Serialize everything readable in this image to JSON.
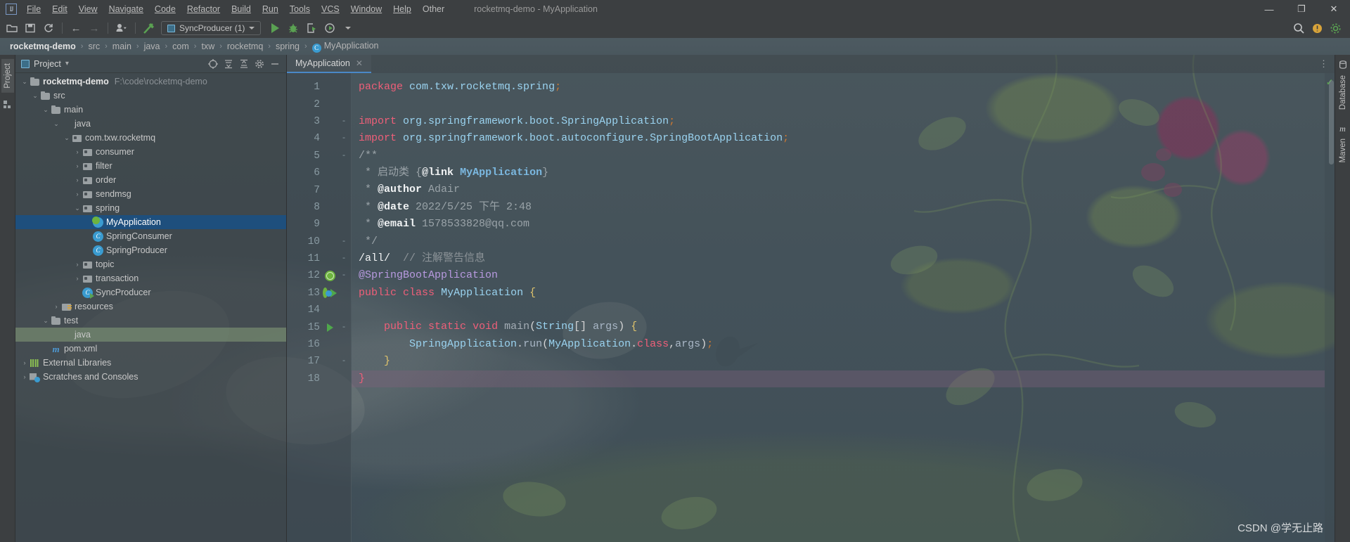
{
  "window": {
    "title": "rocketmq-demo - MyApplication",
    "logo": "IJ",
    "controls": {
      "minimize": "—",
      "maximize": "❐",
      "close": "✕"
    }
  },
  "menubar": {
    "items": [
      {
        "label": "File"
      },
      {
        "label": "Edit"
      },
      {
        "label": "View"
      },
      {
        "label": "Navigate"
      },
      {
        "label": "Code"
      },
      {
        "label": "Refactor"
      },
      {
        "label": "Build"
      },
      {
        "label": "Run"
      },
      {
        "label": "Tools"
      },
      {
        "label": "VCS"
      },
      {
        "label": "Window"
      },
      {
        "label": "Help"
      },
      {
        "label": "Other"
      }
    ]
  },
  "toolbar": {
    "open_icon": "open-folder-icon",
    "save_icon": "save-all-icon",
    "sync_icon": "refresh-icon",
    "back_icon": "←",
    "forward_icon": "→",
    "profile_icon": "user-profile-icon",
    "build_icon": "build-hammer-icon",
    "run_config_label": "SyncProducer (1)",
    "run_label": "run-button",
    "debug_label": "debug-button",
    "coverage_label": "run-with-coverage-button",
    "profile_label": "profiler-button",
    "search_icon": "search-everywhere-icon",
    "settings_icon": "settings-gear-icon",
    "updates_icon": "ide-updates-icon"
  },
  "breadcrumb": {
    "items": [
      {
        "label": "rocketmq-demo",
        "type": "project"
      },
      {
        "label": "src",
        "type": "dir"
      },
      {
        "label": "main",
        "type": "dir"
      },
      {
        "label": "java",
        "type": "dir"
      },
      {
        "label": "com",
        "type": "dir"
      },
      {
        "label": "txw",
        "type": "dir"
      },
      {
        "label": "rocketmq",
        "type": "dir"
      },
      {
        "label": "spring",
        "type": "dir"
      },
      {
        "label": "MyApplication",
        "type": "class"
      }
    ],
    "separator": "›"
  },
  "left_strip": {
    "tabs": [
      {
        "label": "Project",
        "active": true
      }
    ],
    "structure_icon": "structure-icon"
  },
  "right_strip": {
    "tabs": [
      {
        "label": "Database"
      },
      {
        "label": "Maven"
      }
    ]
  },
  "project_panel": {
    "title": "Project",
    "dropdown": "▾",
    "tools": [
      "locate-icon",
      "expand-all-icon",
      "collapse-all-icon",
      "settings-gear-icon",
      "hide-icon"
    ],
    "tree": [
      {
        "indent": 0,
        "arrow": "v",
        "icon": "project",
        "label": "rocketmq-demo",
        "bold": true,
        "path": "F:\\code\\rocketmq-demo"
      },
      {
        "indent": 1,
        "arrow": "v",
        "icon": "folder",
        "label": "src"
      },
      {
        "indent": 2,
        "arrow": "v",
        "icon": "folder",
        "label": "main"
      },
      {
        "indent": 3,
        "arrow": "v",
        "icon": "srcjava",
        "label": "java"
      },
      {
        "indent": 4,
        "arrow": "v",
        "icon": "package",
        "label": "com.txw.rocketmq"
      },
      {
        "indent": 5,
        "arrow": ">",
        "icon": "package",
        "label": "consumer"
      },
      {
        "indent": 5,
        "arrow": ">",
        "icon": "package",
        "label": "filter"
      },
      {
        "indent": 5,
        "arrow": ">",
        "icon": "package",
        "label": "order"
      },
      {
        "indent": 5,
        "arrow": ">",
        "icon": "package",
        "label": "sendmsg"
      },
      {
        "indent": 5,
        "arrow": "v",
        "icon": "package",
        "label": "spring"
      },
      {
        "indent": 6,
        "arrow": "",
        "icon": "springcls",
        "label": "MyApplication",
        "selected": true
      },
      {
        "indent": 6,
        "arrow": "",
        "icon": "class",
        "label": "SpringConsumer"
      },
      {
        "indent": 6,
        "arrow": "",
        "icon": "class",
        "label": "SpringProducer"
      },
      {
        "indent": 5,
        "arrow": ">",
        "icon": "package",
        "label": "topic"
      },
      {
        "indent": 5,
        "arrow": ">",
        "icon": "package",
        "label": "transaction"
      },
      {
        "indent": 5,
        "arrow": "",
        "icon": "classrun",
        "label": "SyncProducer"
      },
      {
        "indent": 3,
        "arrow": ">",
        "icon": "resources",
        "label": "resources"
      },
      {
        "indent": 2,
        "arrow": "v",
        "icon": "folder",
        "label": "test"
      },
      {
        "indent": 3,
        "arrow": "",
        "icon": "testjava",
        "label": "java",
        "selectedGreen": true
      },
      {
        "indent": 2,
        "arrow": "",
        "icon": "maven",
        "label": "pom.xml"
      },
      {
        "indent": 0,
        "arrow": ">",
        "icon": "libs",
        "label": "External Libraries"
      },
      {
        "indent": 0,
        "arrow": ">",
        "icon": "scratch",
        "label": "Scratches and Consoles"
      }
    ]
  },
  "editor": {
    "tabs": [
      {
        "label": "MyApplication",
        "close": "✕",
        "active": true
      }
    ],
    "kebab": "⋮",
    "inspection_status": "✓",
    "lines": [
      {
        "n": 1,
        "gutter": "",
        "fold": "",
        "tokens": [
          {
            "t": "package",
            "c": "kw"
          },
          {
            "t": " ",
            "c": "pun"
          },
          {
            "t": "com.txw.rocketmq.spring",
            "c": "id"
          },
          {
            "t": ";",
            "c": "semi"
          }
        ]
      },
      {
        "n": 2,
        "gutter": "",
        "fold": "",
        "tokens": []
      },
      {
        "n": 3,
        "gutter": "",
        "fold": "-",
        "tokens": [
          {
            "t": "import",
            "c": "kw"
          },
          {
            "t": " ",
            "c": "pun"
          },
          {
            "t": "org.springframework.boot.SpringApplication",
            "c": "id"
          },
          {
            "t": ";",
            "c": "semi"
          }
        ]
      },
      {
        "n": 4,
        "gutter": "",
        "fold": "-",
        "tokens": [
          {
            "t": "import",
            "c": "kw"
          },
          {
            "t": " ",
            "c": "pun"
          },
          {
            "t": "org.springframework.boot.autoconfigure.SpringBootApplication",
            "c": "id"
          },
          {
            "t": ";",
            "c": "semi"
          }
        ]
      },
      {
        "n": 5,
        "gutter": "",
        "fold": "-",
        "tokens": [
          {
            "t": "/**",
            "c": "doc"
          }
        ]
      },
      {
        "n": 6,
        "gutter": "",
        "fold": "",
        "tokens": [
          {
            "t": " * ",
            "c": "doc"
          },
          {
            "t": "启动类 ",
            "c": "doc"
          },
          {
            "t": "{",
            "c": "doc"
          },
          {
            "t": "@link",
            "c": "doctag"
          },
          {
            "t": " ",
            "c": "doc"
          },
          {
            "t": "MyApplication",
            "c": "doclink"
          },
          {
            "t": "}",
            "c": "doc"
          }
        ]
      },
      {
        "n": 7,
        "gutter": "",
        "fold": "",
        "tokens": [
          {
            "t": " * ",
            "c": "doc"
          },
          {
            "t": "@author",
            "c": "doctag"
          },
          {
            "t": " Adair",
            "c": "doc"
          }
        ]
      },
      {
        "n": 8,
        "gutter": "",
        "fold": "",
        "tokens": [
          {
            "t": " * ",
            "c": "doc"
          },
          {
            "t": "@date",
            "c": "doctag"
          },
          {
            "t": " 2022/5/25 下午 2:48",
            "c": "doc"
          }
        ]
      },
      {
        "n": 9,
        "gutter": "",
        "fold": "",
        "tokens": [
          {
            "t": " * ",
            "c": "doc"
          },
          {
            "t": "@email",
            "c": "doctag"
          },
          {
            "t": " 1578533828@qq.com",
            "c": "doc"
          }
        ]
      },
      {
        "n": 10,
        "gutter": "",
        "fold": "-",
        "tokens": [
          {
            "t": " */",
            "c": "doc"
          }
        ]
      },
      {
        "n": 11,
        "gutter": "",
        "fold": "-",
        "tokens": [
          {
            "t": "/all/",
            "c": "white"
          },
          {
            "t": "  ",
            "c": "pun"
          },
          {
            "t": "// 注解警告信息",
            "c": "cmt"
          }
        ]
      },
      {
        "n": 12,
        "gutter": "spring-bean",
        "fold": "-",
        "tokens": [
          {
            "t": "@SpringBootApplication",
            "c": "anno"
          }
        ]
      },
      {
        "n": 13,
        "gutter": "spring-nav-run",
        "fold": "",
        "tokens": [
          {
            "t": "public",
            "c": "kw"
          },
          {
            "t": " ",
            "c": "pun"
          },
          {
            "t": "class",
            "c": "kw"
          },
          {
            "t": " ",
            "c": "pun"
          },
          {
            "t": "MyApplication",
            "c": "id"
          },
          {
            "t": " ",
            "c": "pun"
          },
          {
            "t": "{",
            "c": "brace"
          }
        ]
      },
      {
        "n": 14,
        "gutter": "",
        "fold": "",
        "tokens": []
      },
      {
        "n": 15,
        "gutter": "run",
        "fold": "-",
        "tokens": [
          {
            "t": "    ",
            "c": "pun"
          },
          {
            "t": "public",
            "c": "kw"
          },
          {
            "t": " ",
            "c": "pun"
          },
          {
            "t": "static",
            "c": "kw"
          },
          {
            "t": " ",
            "c": "pun"
          },
          {
            "t": "void",
            "c": "kw"
          },
          {
            "t": " ",
            "c": "pun"
          },
          {
            "t": "main",
            "c": "mth"
          },
          {
            "t": "(",
            "c": "pun"
          },
          {
            "t": "String",
            "c": "id"
          },
          {
            "t": "[] ",
            "c": "pun"
          },
          {
            "t": "args",
            "c": "ident"
          },
          {
            "t": ") ",
            "c": "pun"
          },
          {
            "t": "{",
            "c": "brace"
          }
        ]
      },
      {
        "n": 16,
        "gutter": "",
        "fold": "",
        "tokens": [
          {
            "t": "        ",
            "c": "pun"
          },
          {
            "t": "SpringApplication",
            "c": "id"
          },
          {
            "t": ".",
            "c": "pun"
          },
          {
            "t": "run",
            "c": "ident"
          },
          {
            "t": "(",
            "c": "pun"
          },
          {
            "t": "MyApplication",
            "c": "id"
          },
          {
            "t": ".",
            "c": "pun"
          },
          {
            "t": "class",
            "c": "kw"
          },
          {
            "t": ",",
            "c": "pun"
          },
          {
            "t": "args",
            "c": "ident"
          },
          {
            "t": ")",
            "c": "pun"
          },
          {
            "t": ";",
            "c": "semi"
          }
        ]
      },
      {
        "n": 17,
        "gutter": "",
        "fold": "-",
        "tokens": [
          {
            "t": "    ",
            "c": "pun"
          },
          {
            "t": "}",
            "c": "brace"
          }
        ]
      },
      {
        "n": 18,
        "gutter": "",
        "fold": "",
        "highlight": true,
        "tokens": [
          {
            "t": "}",
            "c": "kw"
          }
        ]
      }
    ]
  },
  "watermark": {
    "text": "CSDN @学无止路"
  },
  "colors": {
    "accent_blue": "#4a88c7",
    "selection_blue": "#1e4f7d",
    "selection_green": "#7e9676",
    "keyword_pink": "#ef5f79",
    "identifier_cyan": "#9ad3f0",
    "annotation_purple": "#b89ae0",
    "comment_grey": "#8c9398",
    "spring_green": "#6db33f",
    "current_line_purple": "#81607c"
  }
}
